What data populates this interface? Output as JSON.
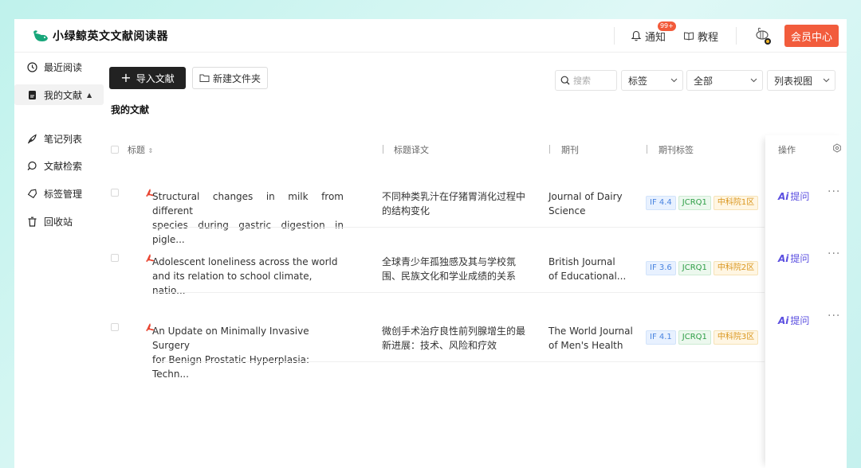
{
  "app": {
    "title": "小绿鲸英文文献阅读器"
  },
  "header": {
    "notify_label": "通知",
    "notify_badge": "99+",
    "tutorial_label": "教程",
    "vip_label": "会员中心"
  },
  "sidebar": {
    "items": [
      {
        "label": "最近阅读",
        "icon": "clock-icon"
      },
      {
        "label": "我的文献",
        "icon": "document-icon"
      },
      {
        "label": "笔记列表",
        "icon": "feather-pen-icon"
      },
      {
        "label": "文献检索",
        "icon": "search-icon"
      },
      {
        "label": "标签管理",
        "icon": "tag-icon"
      },
      {
        "label": "回收站",
        "icon": "trash-icon"
      }
    ]
  },
  "toolbar": {
    "import_label": "导入文献",
    "new_folder_label": "新建文件夹",
    "search_placeholder": "搜索",
    "tag_select": "标签",
    "scope_select": "全部",
    "view_select": "列表视图"
  },
  "main": {
    "title": "我的文献"
  },
  "table": {
    "headers": {
      "title": "标题",
      "translation": "标题译文",
      "journal": "期刊",
      "journal_tags": "期刊标签",
      "actions": "操作"
    },
    "rows": [
      {
        "title_l1": "Structural changes in milk from different",
        "title_l2": "species during gastric digestion in pigle...",
        "trans_l1": "不同种类乳汁在仔猪胃消化过程中",
        "trans_l2": "的结构变化",
        "journal_l1": "Journal of Dairy",
        "journal_l2": "Science",
        "if_tag": "IF 4.4",
        "jcr_tag": "JCRQ1",
        "cas_tag": "中科院1区",
        "ask_label": "提问"
      },
      {
        "title_l1": "Adolescent loneliness across the world",
        "title_l2": "and its relation to school climate, natio...",
        "trans_l1": "全球青少年孤独感及其与学校氛",
        "trans_l2": "围、民族文化和学业成绩的关系",
        "journal_l1": "British Journal",
        "journal_l2": "of Educational...",
        "if_tag": "IF 3.6",
        "jcr_tag": "JCRQ1",
        "cas_tag": "中科院2区",
        "ask_label": "提问"
      },
      {
        "title_l1": "An Update on Minimally Invasive Surgery",
        "title_l2": "for Benign Prostatic Hyperplasia: Techn...",
        "trans_l1": "微创手术治疗良性前列腺增生的最",
        "trans_l2": "新进展：技术、风险和疗效",
        "journal_l1": "The World Journal",
        "journal_l2": "of Men's Health",
        "if_tag": "IF 4.1",
        "jcr_tag": "JCRQ1",
        "cas_tag": "中科院3区",
        "ask_label": "提问"
      }
    ]
  },
  "colors": {
    "accent": "#f25c3c",
    "ask": "#5b4fe0",
    "primary_button": "#222222"
  }
}
